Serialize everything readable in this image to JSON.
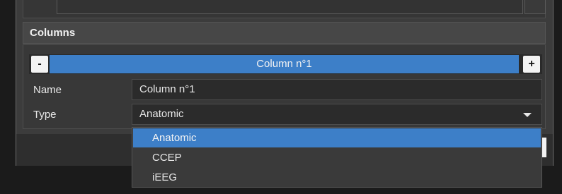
{
  "section": {
    "title": "Columns"
  },
  "column_bar": {
    "minus_label": "-",
    "plus_label": "+",
    "current_column": "Column n°1"
  },
  "name_field": {
    "label": "Name",
    "value": "Column n°1"
  },
  "type_field": {
    "label": "Type",
    "value": "Anatomic",
    "options": [
      "Anatomic",
      "CCEP",
      "iEEG"
    ],
    "selected_index": 0
  },
  "colors": {
    "accent": "#3d7fc8",
    "panel_bg": "#3c3c3c",
    "field_bg": "#2b2b2b"
  }
}
